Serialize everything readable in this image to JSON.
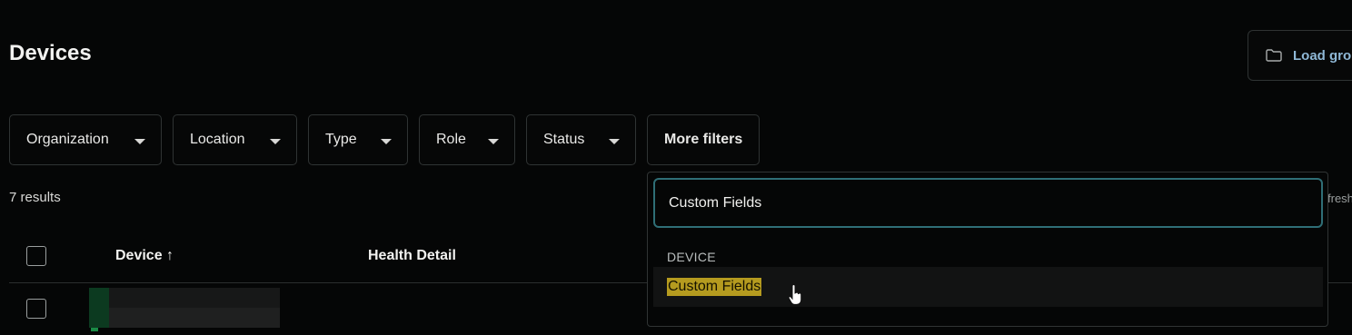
{
  "page": {
    "title": "Devices"
  },
  "toolbar": {
    "load_label": "Load gro"
  },
  "filters": [
    {
      "label": "Organization"
    },
    {
      "label": "Location"
    },
    {
      "label": "Type"
    },
    {
      "label": "Role"
    },
    {
      "label": "Status"
    }
  ],
  "more_filters": {
    "label": "More filters"
  },
  "results": {
    "count_label": "7 results",
    "refresh_label": "fresh"
  },
  "table": {
    "headers": {
      "device": "Device",
      "health": "Health Detail"
    },
    "sort_indicator": "↑"
  },
  "dropdown": {
    "search_value": "Custom Fields",
    "section_label": "DEVICE",
    "options": [
      {
        "label": "Custom Fields"
      }
    ]
  },
  "colors": {
    "accent_focus": "#2f6e76",
    "highlight": "#b59b1f",
    "link": "#8fb8d6"
  },
  "icons": {
    "load": "folder-icon",
    "filter_caret": "caret-down-icon",
    "cursor": "hand-pointer-icon"
  }
}
